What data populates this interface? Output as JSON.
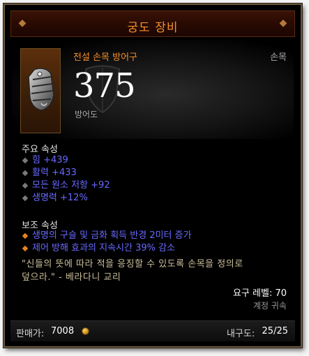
{
  "title": "궁도 장비",
  "item": {
    "type_label": "전설 손목 방어구",
    "slot": "손목",
    "armor_value": "375",
    "armor_label": "방어도",
    "icon": "bracer-icon"
  },
  "primary": {
    "heading": "주요 속성",
    "properties": [
      "힘 +439",
      "활력 +433",
      "모든 원소 저항 +92",
      "생명력 +12%"
    ]
  },
  "secondary": {
    "heading": "보조 속성",
    "properties": [
      "생명의 구슬 및 금화 획득 반경 2미터 증가",
      "제어 방해 효과의 지속시간 39% 감소"
    ]
  },
  "flavor": {
    "line1": "\"신들의 뜻에 따라 적을 응징할 수 있도록 손목을 정의로",
    "line2": "덮으라.\" - 베라다니 교리"
  },
  "requirements": {
    "level": "요구 레벨: 70",
    "bind": "계정 귀속"
  },
  "footer": {
    "sell_label": "판매가:",
    "sell_value": "7008",
    "durability_label": "내구도:",
    "durability_value": "25/25"
  },
  "colors": {
    "legendary": "#f58f2c",
    "magic_property": "#6969ff",
    "flavor_text": "#ccbf9c"
  }
}
